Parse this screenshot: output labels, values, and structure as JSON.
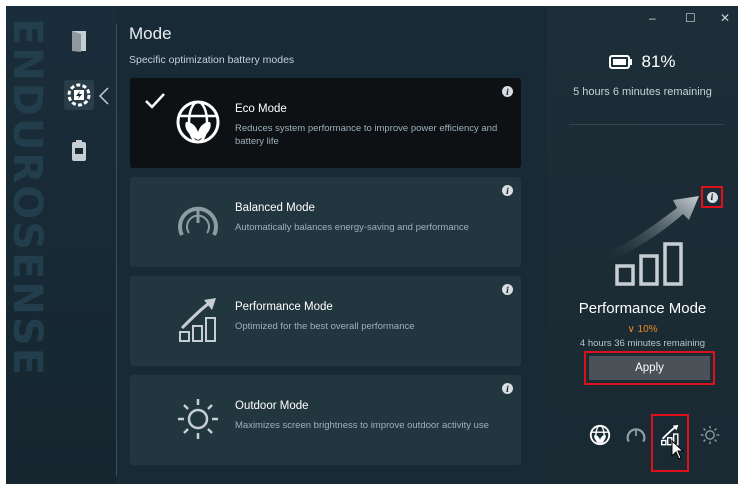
{
  "brand": {
    "text": "ENDUROSENSE"
  },
  "window": {
    "minimize": "–",
    "maximize": "☐",
    "close": "✕"
  },
  "header": {
    "title": "Mode",
    "subtitle": "Specific optimization battery modes"
  },
  "modes": [
    {
      "name": "Eco Mode",
      "desc": "Reduces system performance to improve power efficiency and battery life",
      "selected": true
    },
    {
      "name": "Balanced Mode",
      "desc": "Automatically balances energy-saving and performance",
      "selected": false
    },
    {
      "name": "Performance Mode",
      "desc": "Optimized for the best overall performance",
      "selected": false
    },
    {
      "name": "Outdoor Mode",
      "desc": "Maximizes screen brightness to improve outdoor activity use",
      "selected": false
    }
  ],
  "info_glyph": "i",
  "status": {
    "battery_percent": "81%",
    "time_remaining": "5 hours 6 minutes remaining"
  },
  "preview": {
    "mode_name": "Performance Mode",
    "change_arrow": "∨",
    "change_percent": "10%",
    "time_remaining": "4 hours 36 minutes remaining",
    "apply_label": "Apply"
  },
  "colors": {
    "accent_orange": "#f08a1e",
    "highlight_red": "#e0101a",
    "app_bg": "#172a36"
  }
}
